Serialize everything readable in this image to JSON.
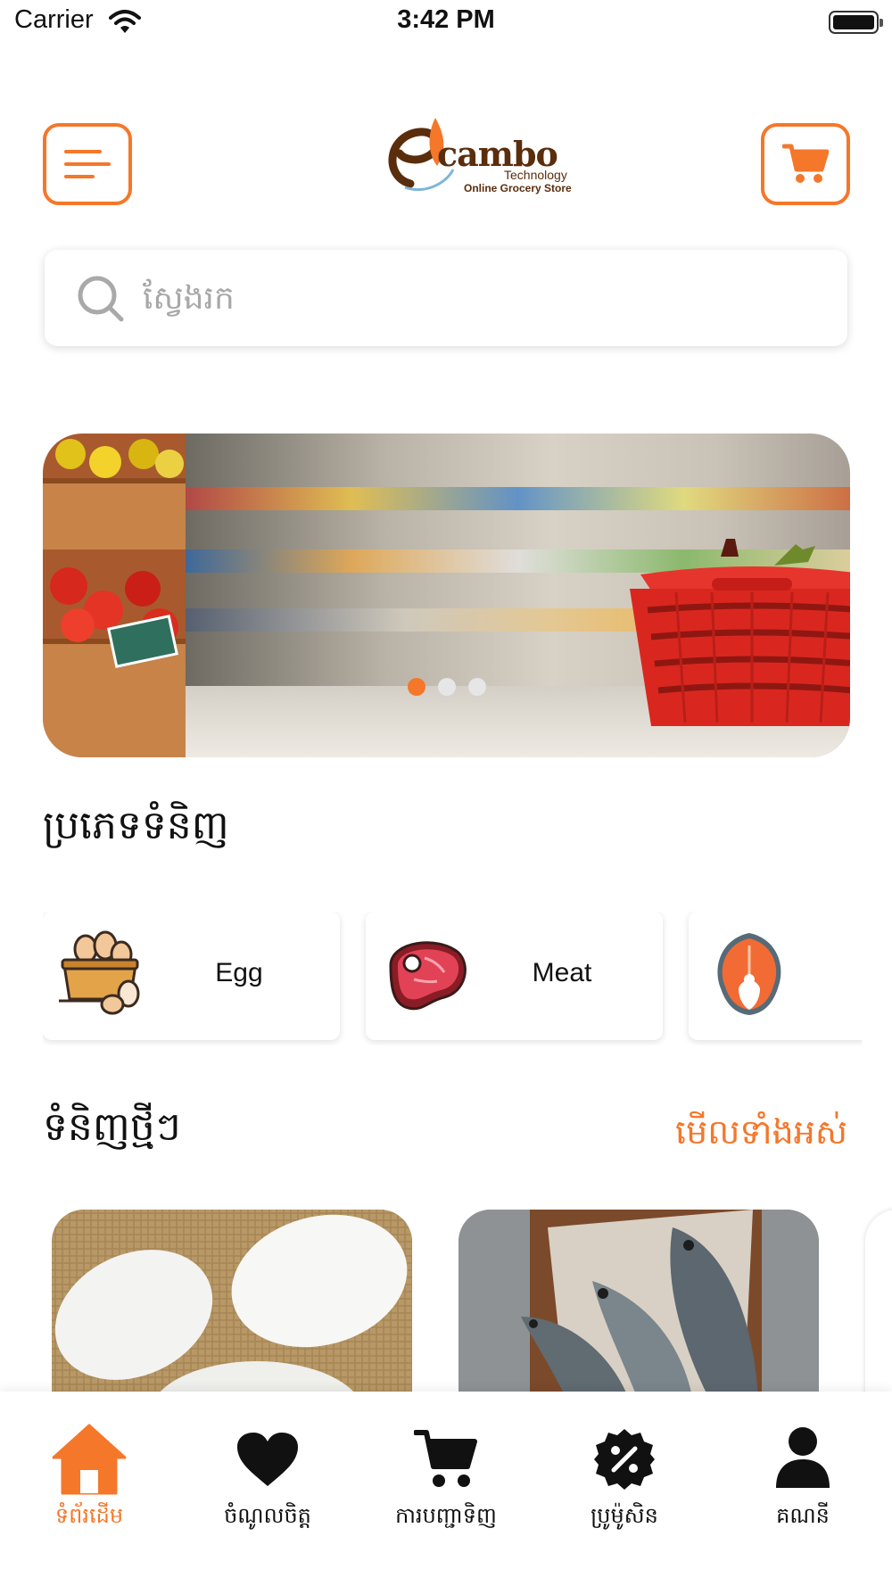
{
  "status_bar": {
    "carrier": "Carrier",
    "time": "3:42 PM"
  },
  "header": {
    "menu_icon": "hamburger-icon",
    "cart_icon": "cart-icon",
    "logo": {
      "word": "cambo",
      "line1": "Technology",
      "line2": "Online Grocery Store"
    }
  },
  "search": {
    "placeholder": "ស្វែងរក",
    "value": ""
  },
  "banner": {
    "slides": 3,
    "active_slide": 1
  },
  "categories": {
    "title": "ប្រភេទទំនិញ",
    "items": [
      {
        "label": "Egg",
        "icon": "egg-basket-icon"
      },
      {
        "label": "Meat",
        "icon": "steak-icon"
      },
      {
        "label": "",
        "icon": "salmon-icon"
      }
    ]
  },
  "new_products": {
    "title": "ទំនិញថ្មីៗ",
    "see_all": "មើលទាំងអស់",
    "items": [
      {
        "image": "eggs"
      },
      {
        "image": "fish"
      }
    ]
  },
  "tab_bar": {
    "active": "home",
    "items": [
      {
        "label": "ទំព័រដើម",
        "icon": "home-icon"
      },
      {
        "label": "ចំណូលចិត្ត",
        "icon": "heart-icon"
      },
      {
        "label": "ការបញ្ជាទិញ",
        "icon": "cart-icon"
      },
      {
        "label": "ប្រូម៉ូសិន",
        "icon": "discount-badge-icon"
      },
      {
        "label": "គណនី",
        "icon": "user-icon"
      }
    ]
  },
  "colors": {
    "accent": "#f5772a",
    "logo_brown": "#5a2d0c"
  }
}
